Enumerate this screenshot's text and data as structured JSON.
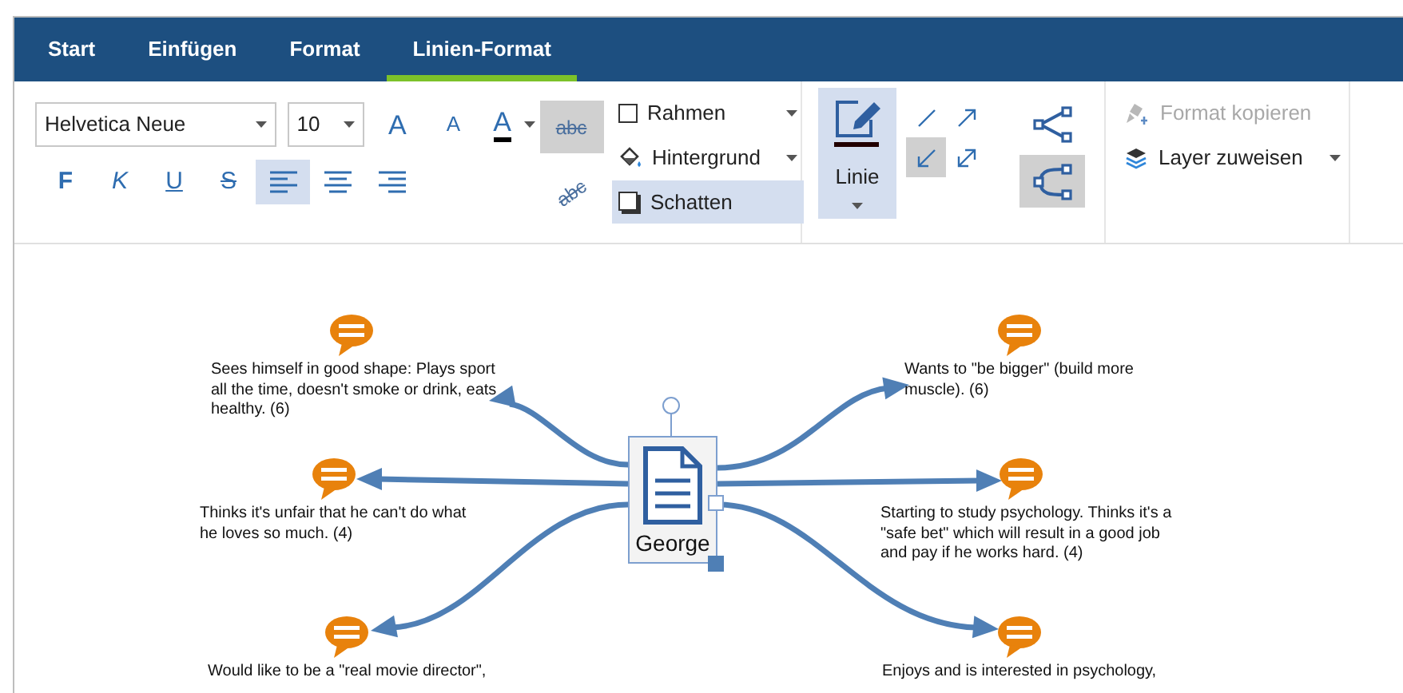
{
  "tabs": [
    {
      "label": "Start",
      "selected": false
    },
    {
      "label": "Einfügen",
      "selected": false
    },
    {
      "label": "Format",
      "selected": false
    },
    {
      "label": "Linien-Format",
      "selected": true
    }
  ],
  "font": {
    "family": "Helvetica Neue",
    "size": "10"
  },
  "text_tools": [
    {
      "kind": "grow",
      "label": "A"
    },
    {
      "kind": "shrink",
      "label": "A"
    },
    {
      "kind": "color",
      "label": "A"
    }
  ],
  "style_buttons": [
    {
      "kind": "bold",
      "label": "F",
      "selected": false
    },
    {
      "kind": "italic",
      "label": "K",
      "selected": false
    },
    {
      "kind": "underline",
      "label": "U",
      "selected": false
    },
    {
      "kind": "strike",
      "label": "S",
      "selected": false
    },
    {
      "kind": "align-left",
      "selected": true
    },
    {
      "kind": "align-center",
      "selected": false
    },
    {
      "kind": "align-right",
      "selected": false
    }
  ],
  "text_effects": [
    {
      "label": "abc",
      "selected": true
    },
    {
      "label": "abc",
      "selected": false
    }
  ],
  "fill_options": [
    {
      "kind": "border",
      "label": "Rahmen",
      "selected": false
    },
    {
      "kind": "background",
      "label": "Hintergrund",
      "selected": false
    },
    {
      "kind": "shadow",
      "label": "Schatten",
      "selected": true
    }
  ],
  "line_button": {
    "label": "Linie",
    "selected": true
  },
  "arrow_styles": [
    {
      "kind": "none",
      "selected": false
    },
    {
      "kind": "end",
      "selected": false
    },
    {
      "kind": "start",
      "selected": true
    },
    {
      "kind": "both",
      "selected": false
    }
  ],
  "connector_styles": [
    {
      "kind": "straight",
      "selected": false
    },
    {
      "kind": "curved",
      "selected": true
    }
  ],
  "arrange": [
    {
      "kind": "copy-format",
      "label": "Format kopieren",
      "disabled": true
    },
    {
      "kind": "layer",
      "label": "Layer zuweisen",
      "disabled": false
    }
  ],
  "map": {
    "center": "George",
    "left_notes": [
      "Sees himself in good shape: Plays sport all the time, doesn't smoke or drink, eats healthy. (6)",
      "Thinks it's unfair that he can't do what he loves so much. (4)",
      "Would like to be a \"real movie director\","
    ],
    "right_notes": [
      "Wants to \"be bigger\" (build more muscle). (6)",
      "Starting to study psychology. Thinks it's a \"safe bet\" which will result in a good job and pay if he works hard. (4)",
      "Enjoys and is interested in psychology,"
    ]
  }
}
